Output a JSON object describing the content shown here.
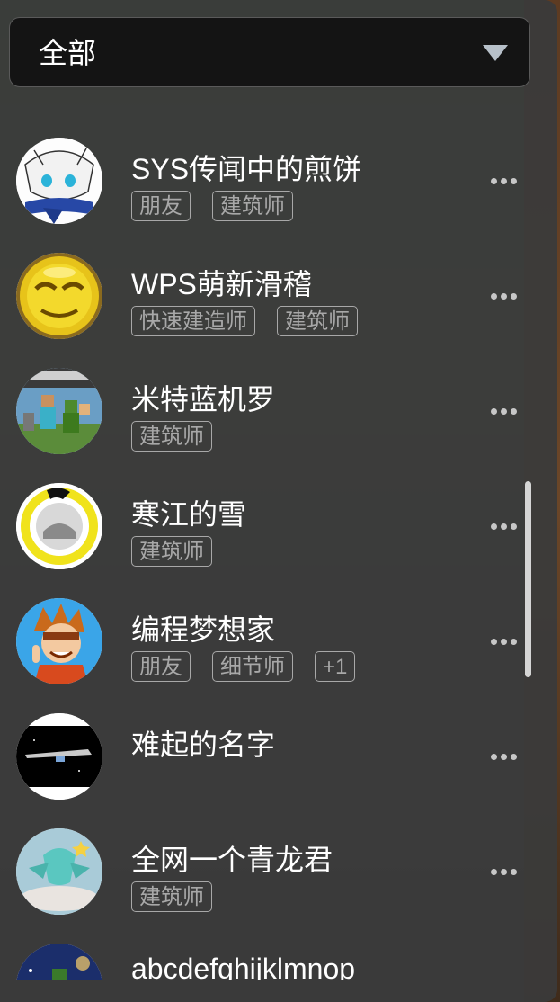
{
  "filter": {
    "selected": "全部"
  },
  "contacts": [
    {
      "name": "SYS传闻中的煎饼",
      "tags": [
        "朋友",
        "建筑师"
      ],
      "avatar": "anime-character-avatar"
    },
    {
      "name": "WPS萌新滑稽",
      "tags": [
        "快速建造师",
        "建筑师"
      ],
      "avatar": "gold-smiley-avatar"
    },
    {
      "name": "米特蓝机罗",
      "tags": [
        "建筑师"
      ],
      "avatar": "minecraft-avatar"
    },
    {
      "name": "寒江的雪",
      "tags": [
        "建筑师"
      ],
      "avatar": "yellow-badge-avatar"
    },
    {
      "name": "编程梦想家",
      "tags": [
        "朋友",
        "细节师",
        "+1"
      ],
      "avatar": "cartoon-boy-avatar"
    },
    {
      "name": "难起的名字",
      "tags": [],
      "avatar": "spaceship-avatar"
    },
    {
      "name": "全网一个青龙君",
      "tags": [
        "建筑师"
      ],
      "avatar": "blue-dragon-avatar"
    },
    {
      "name": "abcdefghijklmnop",
      "tags": [],
      "avatar": "night-sky-avatar"
    }
  ],
  "icons": {
    "more": "more-horizontal-icon",
    "caret": "caret-down-icon"
  }
}
